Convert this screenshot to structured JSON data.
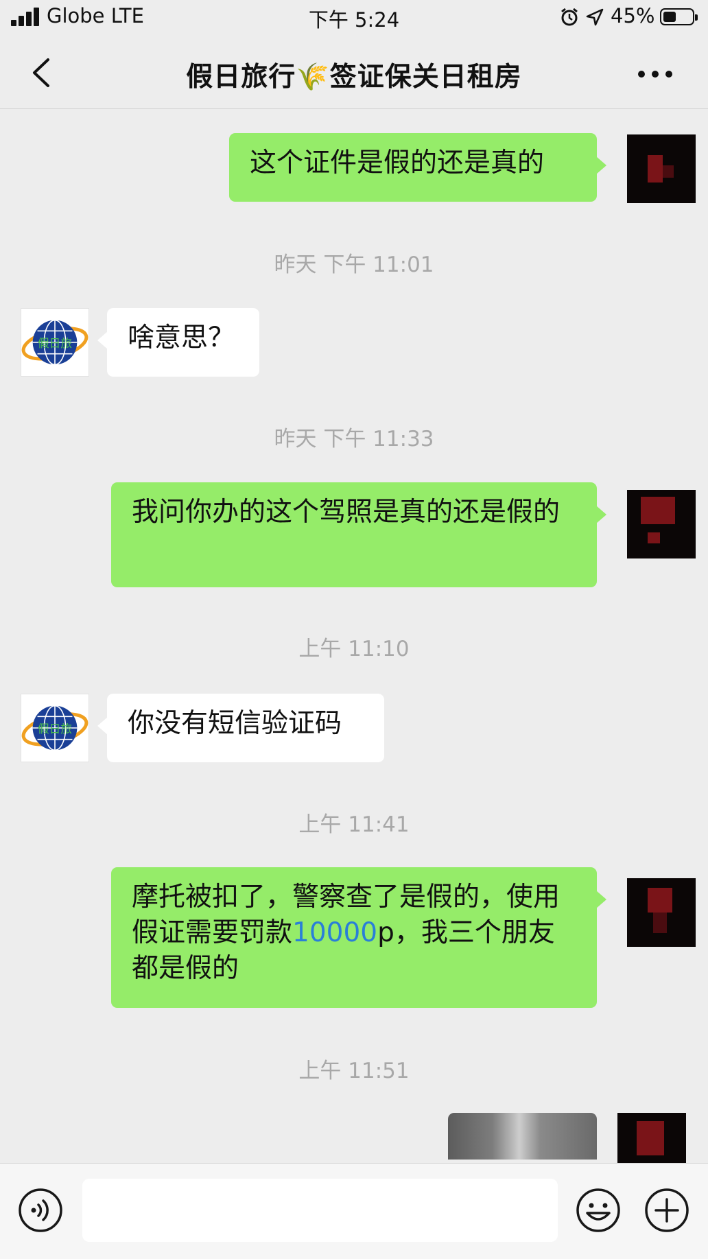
{
  "status_bar": {
    "carrier": "Globe LTE",
    "time": "下午 5:24",
    "battery_pct": "45%",
    "battery_level": 0.45
  },
  "nav": {
    "title": "假日旅行🌾签证保关日租房"
  },
  "messages": [
    {
      "from": "me",
      "text": "这个证件是假的还是真的"
    },
    {
      "timestamp": "昨天 下午 11:01"
    },
    {
      "from": "them",
      "text": "啥意思？"
    },
    {
      "timestamp": "昨天 下午 11:33"
    },
    {
      "from": "me",
      "text": "我问你办的这个驾照是真的还是假的"
    },
    {
      "timestamp": "上午 11:10"
    },
    {
      "from": "them",
      "text": "你没有短信验证码"
    },
    {
      "timestamp": "上午 11:41"
    },
    {
      "from": "me",
      "text_before": "摩托被扣了，警察查了是假的，使用假证需要罚款",
      "link": "10000",
      "text_after": "p，我三个朋友都是假的"
    },
    {
      "timestamp": "上午 11:51"
    }
  ],
  "logo_text": "假日旅",
  "colors": {
    "my_bubble": "#95ec69",
    "their_bubble": "#ffffff",
    "background": "#ededed",
    "link": "#2a7fd8"
  },
  "icons": [
    "signal-icon",
    "alarm-icon",
    "location-arrow-icon",
    "battery-icon",
    "back-chevron-icon",
    "more-dots-icon",
    "voice-icon",
    "emoji-icon",
    "plus-icon"
  ]
}
